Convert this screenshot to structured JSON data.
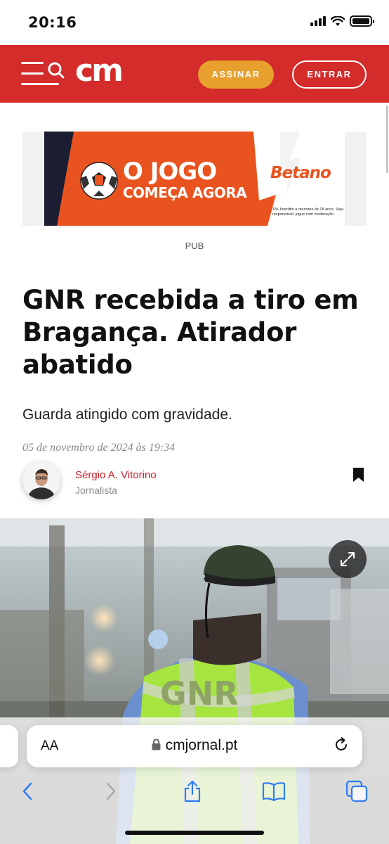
{
  "status_bar": {
    "time": "20:16"
  },
  "header": {
    "logo_text": "cm",
    "subscribe_label": "ASSINAR",
    "login_label": "ENTRAR",
    "brand_color": "#d42b2b",
    "subscribe_color": "#e7a02e"
  },
  "ad": {
    "headline_line1": "O JOGO",
    "headline_line2": "COMEÇA AGORA",
    "brand": "Betano",
    "disclaimer": "18+ Interdito a menores de 18 anos. Seja responsável: jogue com moderação.",
    "pub_label": "PUB"
  },
  "article": {
    "headline": "GNR recebida a tiro em Bragança. Atirador abatido",
    "subtitle": "Guarda atingido com gravidade.",
    "date": "05 de novembro de 2024 às 19:34",
    "author_name": "Sérgio A. Vitorino",
    "author_role": "Jornalista",
    "hero_vest_text": "GNR"
  },
  "browser": {
    "text_size_label": "AA",
    "url": "cmjornal.pt"
  },
  "icons": {
    "menu": "menu-search-icon",
    "bookmark": "bookmark-icon",
    "expand": "expand-icon",
    "lock": "lock-icon",
    "reload": "reload-icon",
    "back": "chevron-left-icon",
    "forward": "chevron-right-icon",
    "share": "share-icon",
    "bookmarks": "book-icon",
    "tabs": "tabs-icon"
  }
}
